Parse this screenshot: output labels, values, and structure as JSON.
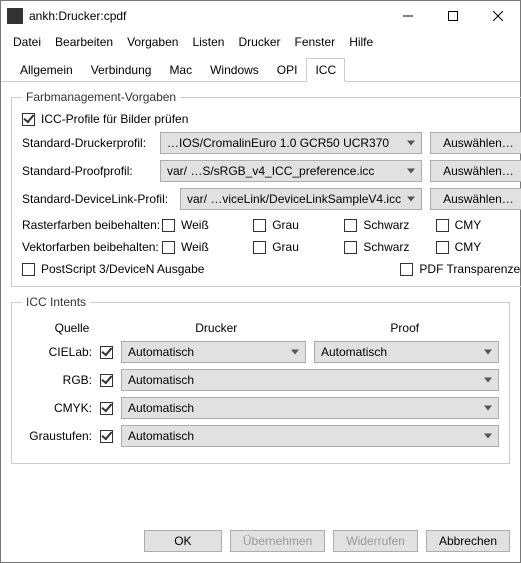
{
  "window": {
    "title": "ankh:Drucker:cpdf"
  },
  "menu": [
    "Datei",
    "Bearbeiten",
    "Vorgaben",
    "Listen",
    "Drucker",
    "Fenster",
    "Hilfe"
  ],
  "tabs": [
    "Allgemein",
    "Verbindung",
    "Mac",
    "Windows",
    "OPI",
    "ICC"
  ],
  "fm": {
    "legend": "Farbmanagement-Vorgaben",
    "chk_profiles": "ICC-Profile für Bilder prüfen",
    "rows": {
      "printer": {
        "label": "Standard-Druckerprofil:",
        "value": "…IOS/CromalinEuro 1.0 GCR50 UCR370",
        "btn": "Auswählen…"
      },
      "proof": {
        "label": "Standard-Proofprofil:",
        "value": "var/ …S/sRGB_v4_ICC_preference.icc",
        "btn": "Auswählen…"
      },
      "devlink": {
        "label": "Standard-DeviceLink-Profil:",
        "value": "var/ …viceLink/DeviceLinkSampleV4.icc",
        "btn": "Auswählen…"
      }
    },
    "raster_label": "Rasterfarben beibehalten:",
    "vector_label": "Vektorfarben beibehalten:",
    "colors": [
      "Weiß",
      "Grau",
      "Schwarz",
      "CMY"
    ],
    "ps3": "PostScript 3/DeviceN Ausgabe",
    "pdftrans": "PDF Transparenzen"
  },
  "intents": {
    "legend": "ICC Intents",
    "hdr": {
      "q": "Quelle",
      "d": "Drucker",
      "p": "Proof"
    },
    "rows": [
      {
        "label": "CIELab:",
        "d": "Automatisch",
        "p": "Automatisch"
      },
      {
        "label": "RGB:",
        "d": "Automatisch"
      },
      {
        "label": "CMYK:",
        "d": "Automatisch"
      },
      {
        "label": "Graustufen:",
        "d": "Automatisch"
      }
    ]
  },
  "footer": {
    "ok": "OK",
    "apply": "Übernehmen",
    "revert": "Widerrufen",
    "cancel": "Abbrechen"
  }
}
